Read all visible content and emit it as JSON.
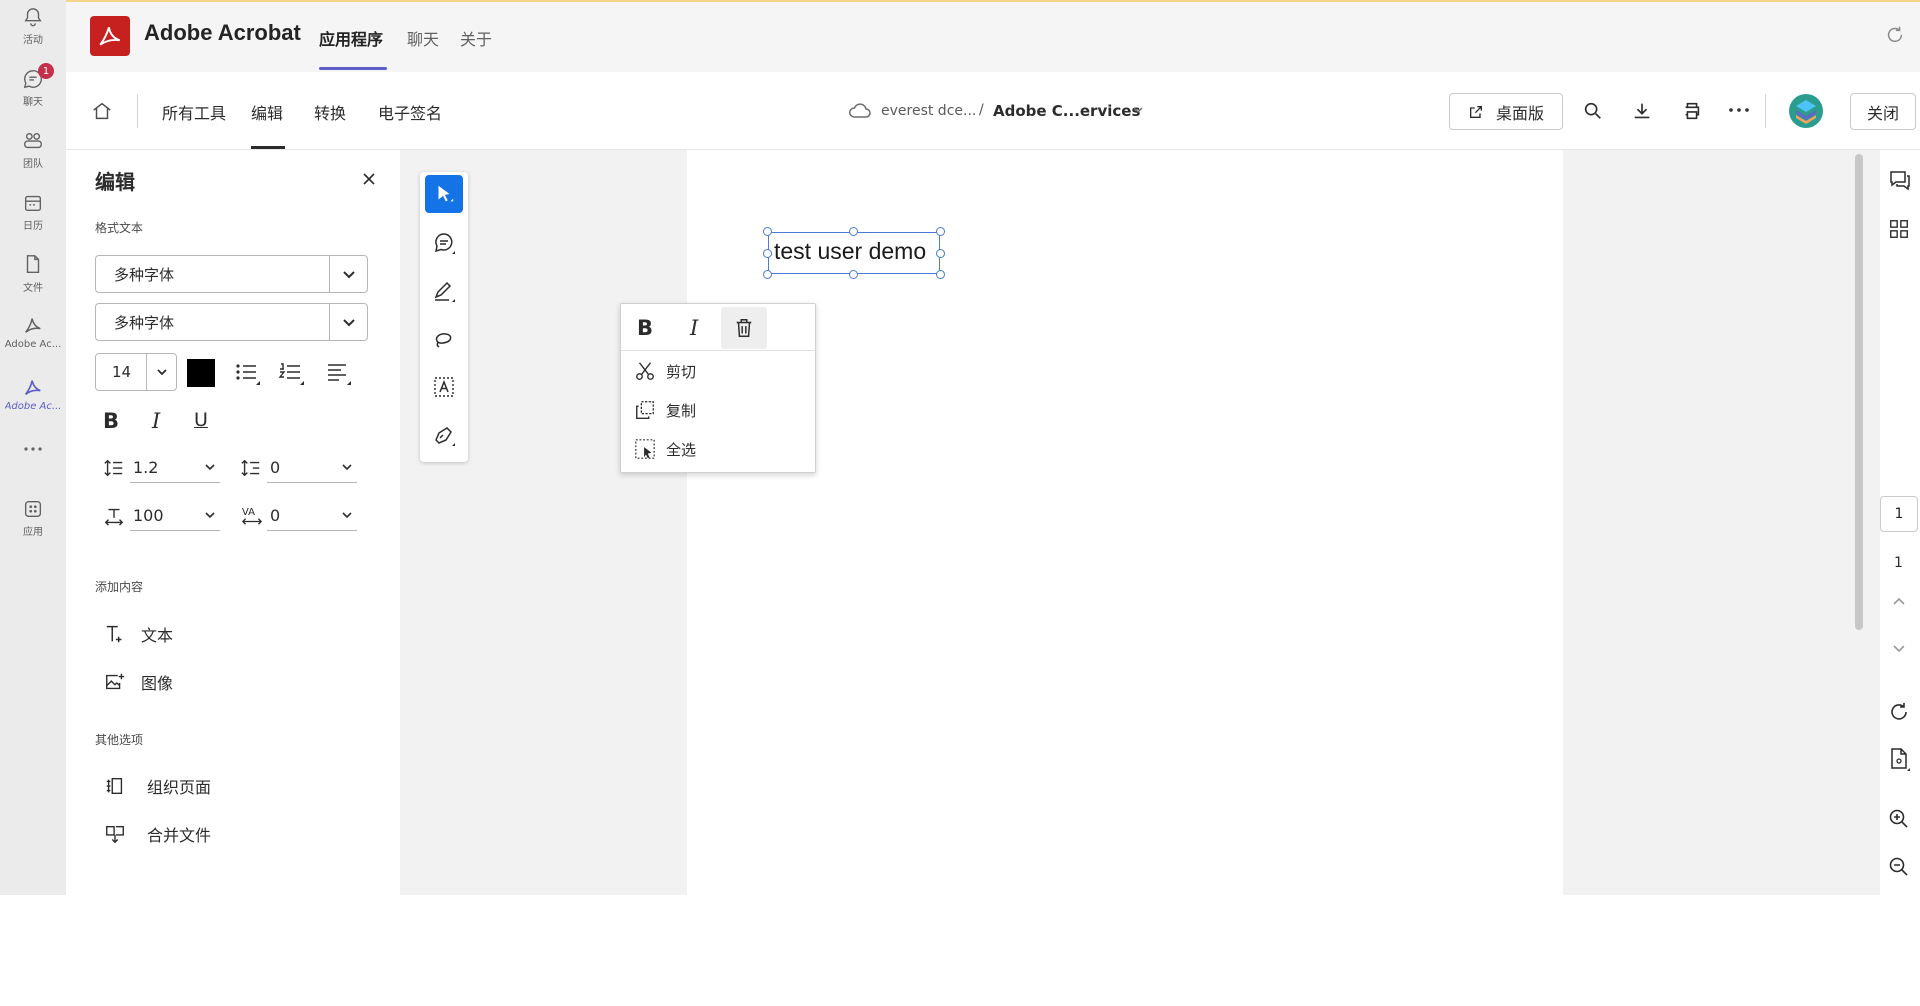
{
  "rail": {
    "items": [
      {
        "label": "活动",
        "icon": "bell-icon"
      },
      {
        "label": "聊天",
        "icon": "chat-icon",
        "badge": "1"
      },
      {
        "label": "团队",
        "icon": "teams-icon"
      },
      {
        "label": "日历",
        "icon": "calendar-icon"
      },
      {
        "label": "文件",
        "icon": "file-icon"
      },
      {
        "label": "Adobe Ac...",
        "icon": "acrobat-icon"
      },
      {
        "label": "Adobe Ac...",
        "icon": "acrobat-icon",
        "active": true
      },
      {
        "label": "...",
        "icon": "more-icon"
      },
      {
        "label": "应用",
        "icon": "apps-icon"
      }
    ]
  },
  "header": {
    "app_name": "Adobe Acrobat",
    "tabs": [
      "应用程序",
      "聊天",
      "关于"
    ],
    "active_tab": "应用程序"
  },
  "toolbar": {
    "tabs": [
      "所有工具",
      "编辑",
      "转换",
      "电子签名"
    ],
    "active_tab": "编辑",
    "breadcrumb": {
      "location": "everest dce...",
      "separator": "/",
      "document": "Adobe C...ervices"
    },
    "desktop_button": "桌面版",
    "close_button": "关闭"
  },
  "panel": {
    "title": "编辑",
    "format_text_label": "格式文本",
    "font_family": "多种字体",
    "font_style": "多种字体",
    "font_size": "14",
    "text_color": "#000000",
    "line_spacing": "1.2",
    "paragraph_spacing": "0",
    "horizontal_scale": "100",
    "char_spacing": "0",
    "bold": "B",
    "italic": "I",
    "underline": "U",
    "add_content_label": "添加内容",
    "add_text": "文本",
    "add_image": "图像",
    "other_options_label": "其他选项",
    "organize_pages": "组织页面",
    "merge_files": "合并文件"
  },
  "document": {
    "text_box": "test user demo"
  },
  "context_menu": {
    "bold": "B",
    "italic": "I",
    "cut": "剪切",
    "copy": "复制",
    "select_all": "全选"
  },
  "page_nav": {
    "current_page": "1",
    "total_pages": "1"
  },
  "colors": {
    "accent": "#5b5fc7",
    "adobe_red": "#c7211f",
    "selection_blue": "#1473e6"
  }
}
